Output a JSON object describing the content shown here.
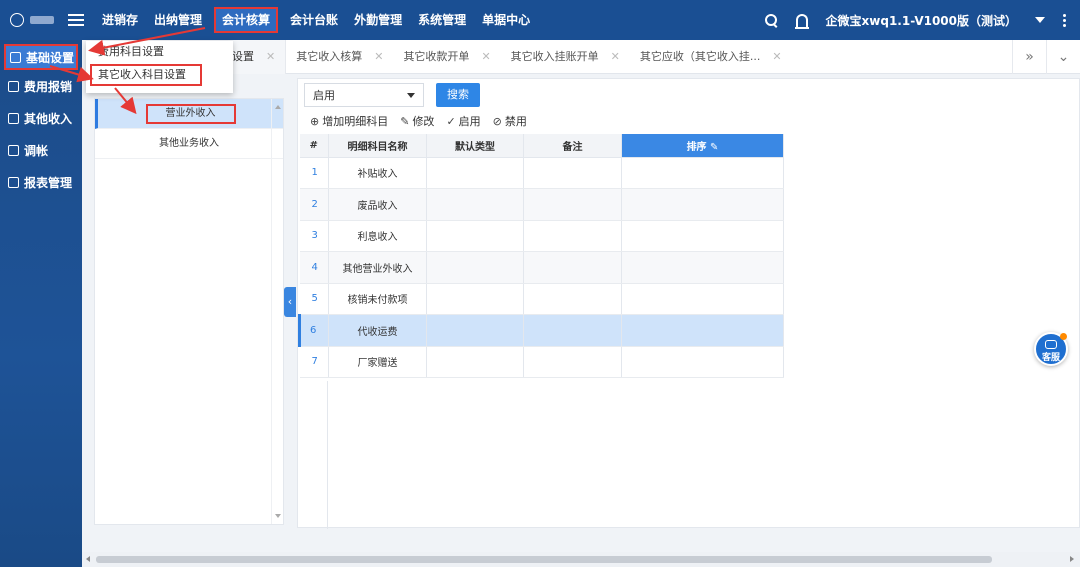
{
  "topbar": {
    "nav": [
      "进销存",
      "出纳管理",
      "会计核算",
      "会计台账",
      "外勤管理",
      "系统管理",
      "单据中心"
    ],
    "active_nav": "会计核算",
    "company": "企微宝xwq1.1-V1000版（测试）"
  },
  "sidebar": {
    "items": [
      {
        "label": "基础设置",
        "icon": "layers-icon"
      },
      {
        "label": "费用报销",
        "icon": "receipt-icon"
      },
      {
        "label": "其他收入",
        "icon": "income-icon"
      },
      {
        "label": "调帐",
        "icon": "grid-icon"
      },
      {
        "label": "报表管理",
        "icon": "report-icon"
      }
    ]
  },
  "popup": {
    "items": [
      "费用科目设置",
      "其它收入科目设置"
    ]
  },
  "tabs": [
    {
      "label": "设置"
    },
    {
      "label": "其它收入核算"
    },
    {
      "label": "其它收款开单"
    },
    {
      "label": "其它收入挂账开单"
    },
    {
      "label": "其它应收（其它收入挂..."
    }
  ],
  "tree": {
    "items": [
      "营业外收入",
      "其他业务收入"
    ]
  },
  "filter": {
    "status_value": "启用",
    "search_label": "搜索"
  },
  "toolbar": {
    "add_label": "增加明细科目",
    "edit_label": "修改",
    "enable_label": "启用",
    "disable_label": "禁用"
  },
  "table": {
    "headers": [
      "#",
      "明细科目名称",
      "默认类型",
      "备注",
      "排序"
    ],
    "rows": [
      {
        "n": "1",
        "name": "补贴收入"
      },
      {
        "n": "2",
        "name": "废品收入"
      },
      {
        "n": "3",
        "name": "利息收入"
      },
      {
        "n": "4",
        "name": "其他营业外收入"
      },
      {
        "n": "5",
        "name": "核销未付款项"
      },
      {
        "n": "6",
        "name": "代收运费"
      },
      {
        "n": "7",
        "name": "厂家赠送"
      }
    ]
  },
  "service": {
    "label": "客服"
  },
  "colors": {
    "topbar": "#1a4f93",
    "accent": "#2e86e6",
    "highlight": "#e53935",
    "selected_row": "#cfe3fa"
  }
}
